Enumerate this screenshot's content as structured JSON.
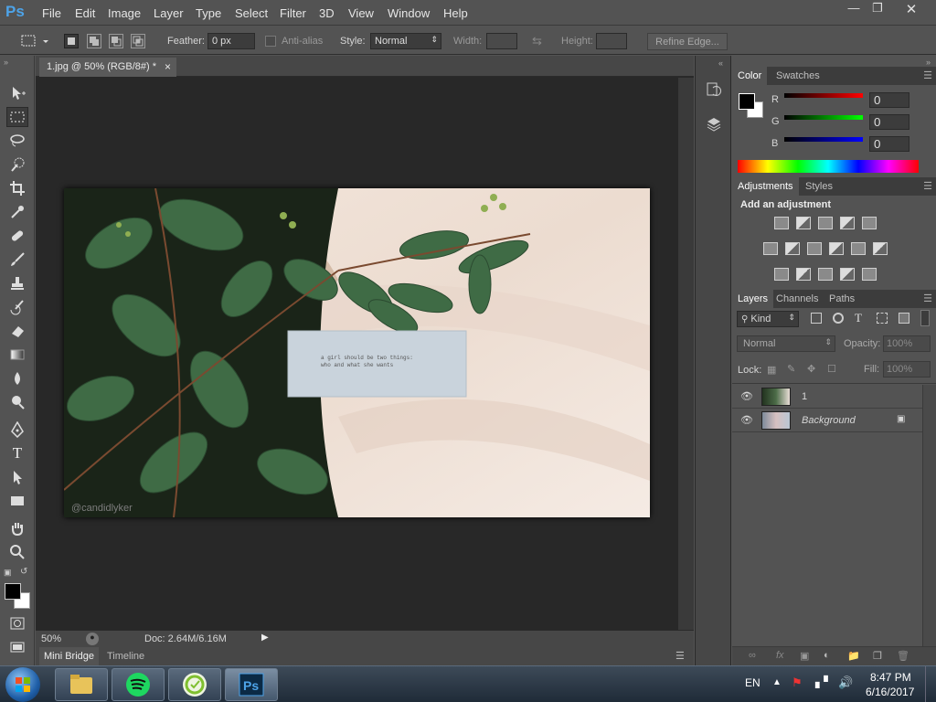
{
  "app": {
    "logo": "Ps",
    "menu": [
      "File",
      "Edit",
      "Image",
      "Layer",
      "Type",
      "Select",
      "Filter",
      "3D",
      "View",
      "Window",
      "Help"
    ]
  },
  "options": {
    "feather_label": "Feather:",
    "feather_value": "0 px",
    "antialias_label": "Anti-alias",
    "style_label": "Style:",
    "style_value": "Normal",
    "width_label": "Width:",
    "height_label": "Height:",
    "refine_label": "Refine Edge..."
  },
  "document": {
    "tab_title": "1.jpg @ 50% (RGB/8#) *",
    "close": "×",
    "image_caption_line1": "a girl should be two things:",
    "image_caption_line2": "who and what she wants",
    "watermark": "@candidlyker",
    "zoom": "50%",
    "doc_info": "Doc: 2.64M/6.16M"
  },
  "bottom_tabs": [
    "Mini Bridge",
    "Timeline"
  ],
  "color_panel": {
    "tabs": [
      "Color",
      "Swatches"
    ],
    "channels": [
      {
        "label": "R",
        "value": "0"
      },
      {
        "label": "G",
        "value": "0"
      },
      {
        "label": "B",
        "value": "0"
      }
    ]
  },
  "adjustments_panel": {
    "tabs": [
      "Adjustments",
      "Styles"
    ],
    "heading": "Add an adjustment"
  },
  "layers_panel": {
    "tabs": [
      "Layers",
      "Channels",
      "Paths"
    ],
    "kind_label": "Kind",
    "blend_mode": "Normal",
    "opacity_label": "Opacity:",
    "opacity_value": "100%",
    "lock_label": "Lock:",
    "fill_label": "Fill:",
    "fill_value": "100%",
    "layers": [
      {
        "name": "1"
      },
      {
        "name": "Background"
      }
    ]
  },
  "taskbar": {
    "language": "EN",
    "time": "8:47 PM",
    "date": "6/16/2017"
  },
  "colors": {
    "accent": "#4da3e8",
    "panel": "#535353",
    "canvas_bg": "#282828"
  }
}
